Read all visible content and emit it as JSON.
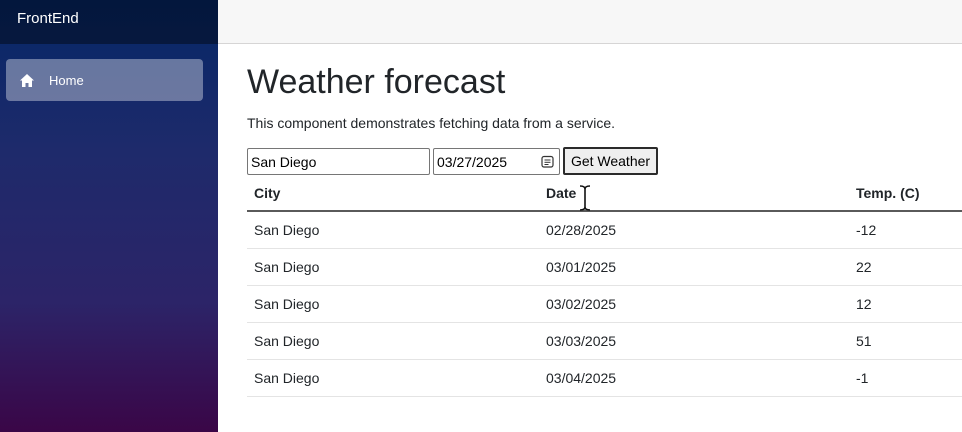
{
  "app": {
    "brand": "FrontEnd"
  },
  "sidebar": {
    "items": [
      {
        "label": "Home",
        "icon": "home-icon"
      }
    ]
  },
  "page": {
    "title": "Weather forecast",
    "description": "This component demonstrates fetching data from a service."
  },
  "form": {
    "city_value": "San Diego",
    "date_value": "03/27/2025",
    "button_label": "Get Weather"
  },
  "table": {
    "headers": [
      "City",
      "Date",
      "Temp. (C)"
    ],
    "rows": [
      [
        "San Diego",
        "02/28/2025",
        "-12"
      ],
      [
        "San Diego",
        "03/01/2025",
        "22"
      ],
      [
        "San Diego",
        "03/02/2025",
        "12"
      ],
      [
        "San Diego",
        "03/03/2025",
        "51"
      ],
      [
        "San Diego",
        "03/04/2025",
        "-1"
      ]
    ]
  },
  "colors": {
    "sidebar_top": "#052767",
    "sidebar_bottom": "#3a0647",
    "nav_active": "#ffffff5e"
  }
}
